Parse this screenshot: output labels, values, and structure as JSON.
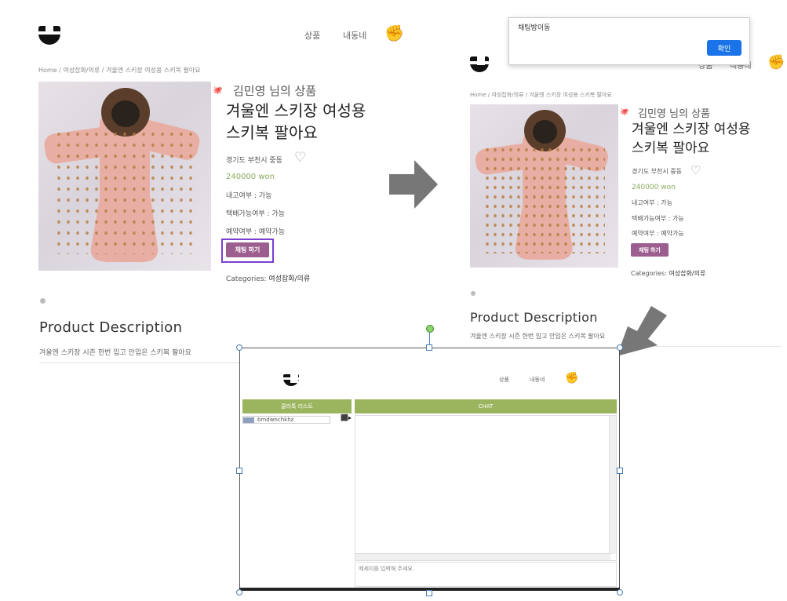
{
  "left": {
    "nav": {
      "products": "상품",
      "neighborhood": "내동네"
    },
    "breadcrumb": {
      "home": "Home",
      "sep1": " / ",
      "category": "여성잡화/의류",
      "sep2": " / ",
      "current": "겨울엔 스키장 여성용 스키복 팔아요"
    },
    "product": {
      "seller": "김민영 님의 상품",
      "title_line1": "겨울엔 스키장 여성용",
      "title_line2": "스키복 팔아요",
      "location": "경기도 부천시 중동",
      "price": "240000 won",
      "used": "내고여부 : 가능",
      "delivery": "택배가능여부 : 가능",
      "reserve": "예약여부 : 예약가능",
      "chat_button": "채팅 하기",
      "categories_label": "Categories: ",
      "categories_value": "여성잡화/의류"
    },
    "description": {
      "title": "Product Description",
      "text": "겨울엔 스키장 시즌 한번 입고 안입은 스키복 팔아요"
    }
  },
  "right": {
    "dialog": {
      "message": "채팅방이동",
      "ok": "확인"
    },
    "nav": {
      "products": "상품",
      "neighborhood": "내동네"
    },
    "breadcrumb": {
      "home": "Home",
      "sep1": " / ",
      "category": "여성잡화/의류",
      "sep2": " / ",
      "current": "겨울엔 스키장 여성용 스키복 팔아요"
    },
    "product": {
      "seller": "김민영 님의 상품",
      "title_line1": "겨울엔 스키장 여성용",
      "title_line2": "스키복 팔아요",
      "location": "경기도 부천시 중동",
      "price": "240000 won",
      "used": "내고여부 : 가능",
      "delivery": "택배가능여부 : 가능",
      "reserve": "예약여부 : 예약가능",
      "chat_button": "채팅 하기",
      "categories_label": "Categories: ",
      "categories_value": "여성잡화/의류"
    },
    "description": {
      "title": "Product Description",
      "text": "겨울엔 스키장 시즌 한번 입고 안입은 스키복 팔아요"
    }
  },
  "chat": {
    "nav": {
      "products": "상품",
      "neighborhood": "내동네"
    },
    "client_list_header": "클라톡 리스트",
    "chat_header": "CHAT",
    "users": [
      {
        "id": "bmdwnchkhz"
      }
    ],
    "input_placeholder": "메세지를 입력해 주세요."
  },
  "colors": {
    "accent_purple": "#9b5e8e",
    "price_green": "#8aab5d",
    "chat_green": "#9bb55e",
    "confirm_blue": "#1a73e8",
    "highlight": "#7a3fd0"
  }
}
